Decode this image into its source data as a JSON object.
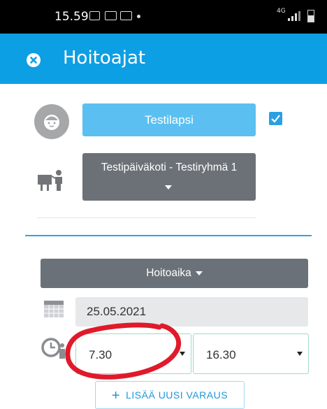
{
  "status_bar": {
    "time": "15.59",
    "network": "4G"
  },
  "app_bar": {
    "title": "Hoitoajat",
    "close_icon": "close-circle-icon"
  },
  "child": {
    "name": "Testilapsi",
    "selected": true,
    "avatar_icon": "child-face-icon"
  },
  "group": {
    "label": "Testipäiväkoti - Testiryhmä 1",
    "icon": "classroom-icon"
  },
  "reservation": {
    "mode_label": "Hoitoaika",
    "date": "25.05.2021",
    "start_time": "7.30",
    "end_time": "16.30",
    "add_button_label": "LISÄÄ UUSI VARAUS"
  },
  "colors": {
    "app_bar": "#0c9fe4",
    "child_button": "#5bc0f1",
    "dark_button": "#6c7177",
    "annotation": "#e01a2b"
  }
}
